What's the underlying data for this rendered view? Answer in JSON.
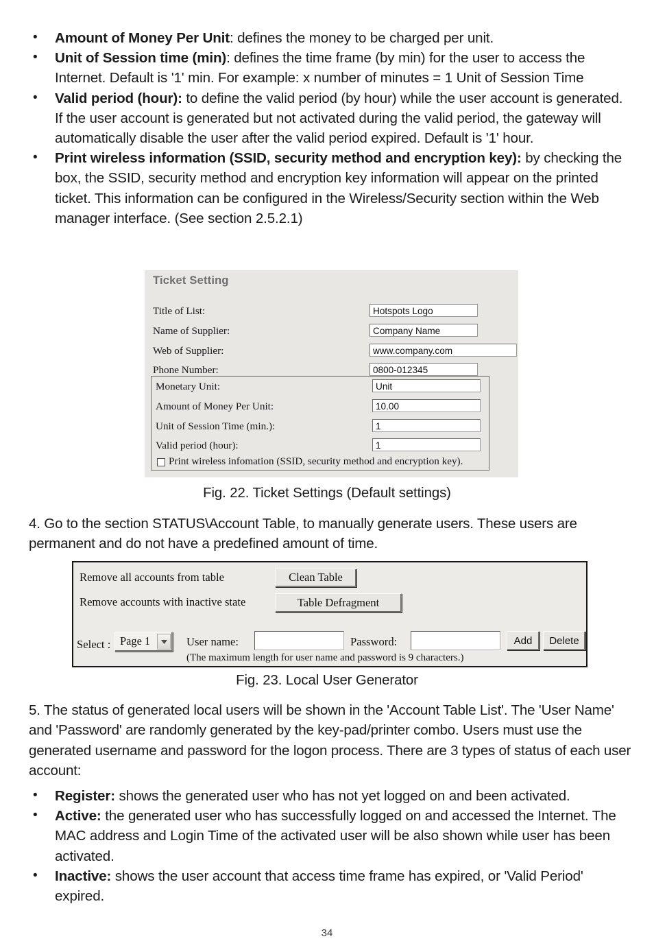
{
  "page": {
    "number": "34"
  },
  "bullets_top": [
    {
      "lead": "Amount of Money Per Unit",
      "rest": ": defines the money to be charged per unit."
    },
    {
      "lead": "Unit of Session time (min)",
      "rest": ": defines the time frame (by min) for the user to access the Internet. Default is '1' min. For example: x number of minutes = 1 Unit of Session Time"
    },
    {
      "lead": "Valid period (hour):",
      "rest": " to define the valid period (by hour) while the user account is generated. If the user account is generated but not activated during the valid period, the gateway will automatically disable the user after the valid period expired. Default is '1' hour."
    },
    {
      "lead": "Print wireless information (SSID, security method and encryption key):",
      "rest": " by checking the box, the SSID, security method and encryption key information will appear on the printed ticket. This information can be configured in the Wireless/Security section within the Web manager interface. (See section 2.5.2.1)"
    }
  ],
  "fig22": {
    "title": "Ticket Setting",
    "caption": "Fig. 22. Ticket Settings (Default settings)",
    "fields": [
      {
        "label": "Title of List:",
        "value": "Hotspots Logo"
      },
      {
        "label": "Name of Supplier:",
        "value": "Company Name"
      },
      {
        "label": "Web of Supplier:",
        "value": "www.company.com"
      },
      {
        "label": "Phone Number:",
        "value": "0800-012345"
      }
    ],
    "group_fields": [
      {
        "label": "Monetary Unit:",
        "value": "Unit"
      },
      {
        "label": "Amount of Money Per Unit:",
        "value": "10.00"
      },
      {
        "label": "Unit of Session Time (min.):",
        "value": "1"
      },
      {
        "label": "Valid period (hour):",
        "value": "1"
      }
    ],
    "checkbox": {
      "label": "Print wireless infomation (SSID, security method and encryption key).",
      "checked": false
    }
  },
  "step4": "4.  Go to the section STATUS\\Account Table, to manually generate users. These users are permanent and do not have a predefined amount of time.",
  "fig23": {
    "caption": "Fig. 23. Local User Generator",
    "row1_label": "Remove all accounts from table",
    "row1_button": "Clean Table",
    "row2_label": "Remove accounts with inactive state",
    "row2_button": "Table Defragment",
    "select_label": "Select :",
    "select_value": "Page 1",
    "username_label": "User name:",
    "username_value": "",
    "password_label": "Password:",
    "password_value": "",
    "add_button": "Add",
    "delete_button": "Delete",
    "hint": "(The maximum length for user name and password is 9 characters.)"
  },
  "step5": "5.  The status of generated local users will be shown in the 'Account Table List'. The 'User Name' and 'Password' are randomly generated by the key-pad/printer combo. Users must use the generated username and password for the logon process. There are 3 types of status of each user account:",
  "bullets_bottom": [
    {
      "lead": "Register:",
      "rest": " shows the generated user who has not yet logged on and been activated."
    },
    {
      "lead": "Active:",
      "rest": " the generated user who has successfully logged on and accessed the Internet. The MAC address and Login Time of the activated user will be also shown while user has been activated."
    },
    {
      "lead": "Inactive:",
      "rest": " shows the user account that access time frame has expired, or 'Valid Period' expired."
    }
  ]
}
